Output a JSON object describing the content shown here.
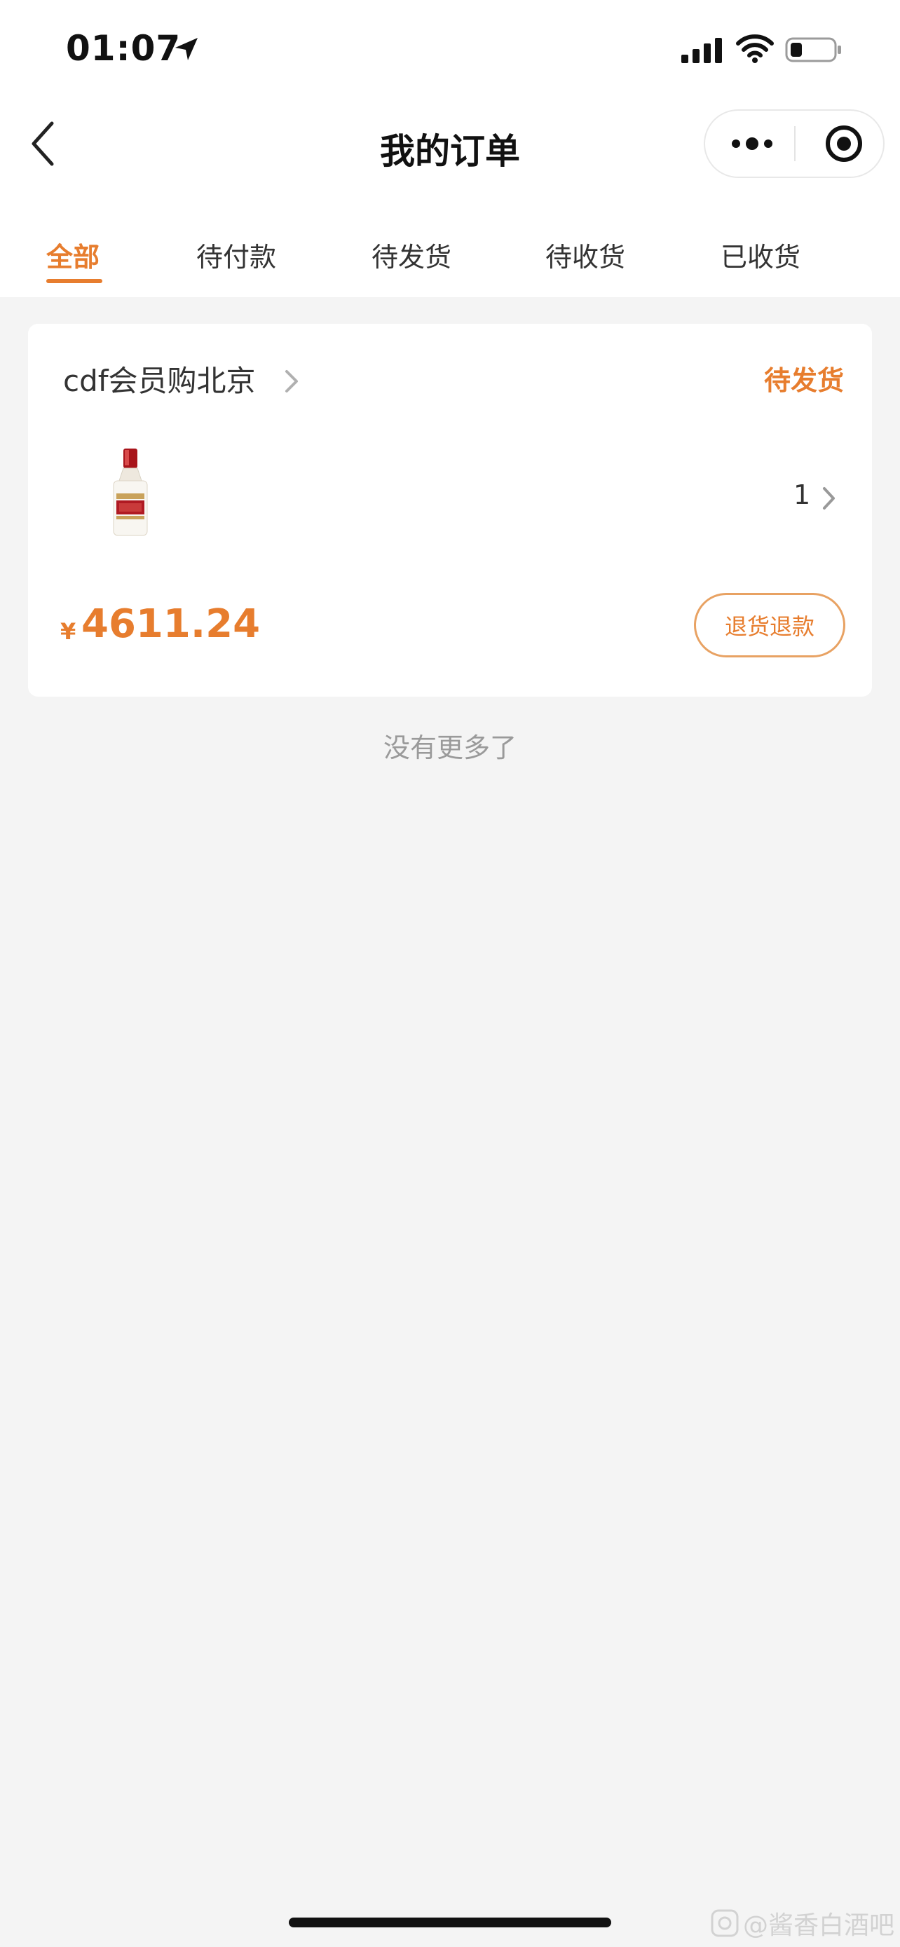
{
  "status_bar": {
    "time": "01:07"
  },
  "nav": {
    "title": "我的订单"
  },
  "tabs": [
    {
      "label": "全部",
      "active": true
    },
    {
      "label": "待付款",
      "active": false
    },
    {
      "label": "待发货",
      "active": false
    },
    {
      "label": "待收货",
      "active": false
    },
    {
      "label": "已收货",
      "active": false
    }
  ],
  "order": {
    "store_name": "cdf会员购北京",
    "status": "待发货",
    "quantity": "1",
    "currency_symbol": "¥",
    "price": "4611.24",
    "refund_button_label": "退货退款"
  },
  "list_footer": "没有更多了",
  "watermark": "@酱香白酒吧",
  "colors": {
    "accent": "#e77d2e",
    "page_background": "#f4f4f4",
    "card_background": "#ffffff"
  }
}
